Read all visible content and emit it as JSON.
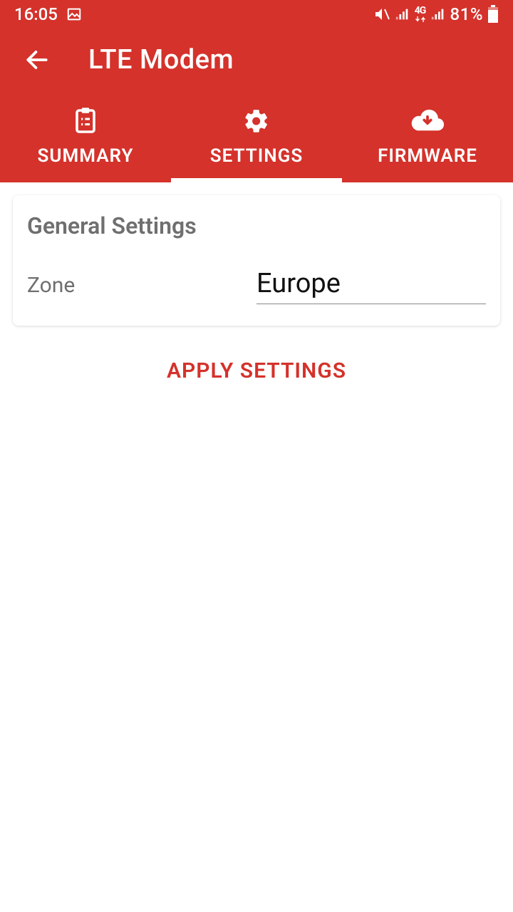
{
  "status": {
    "time": "16:05",
    "battery_pct": "81%"
  },
  "appbar": {
    "title": "LTE Modem"
  },
  "tabs": {
    "summary": "SUMMARY",
    "settings": "SETTINGS",
    "firmware": "FIRMWARE",
    "active": "settings"
  },
  "card": {
    "title": "General Settings",
    "zone_label": "Zone",
    "zone_value": "Europe"
  },
  "actions": {
    "apply": "APPLY SETTINGS"
  }
}
